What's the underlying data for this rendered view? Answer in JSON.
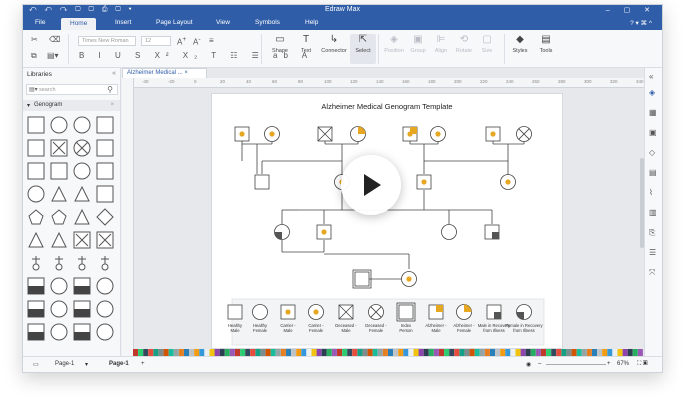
{
  "titlebar": {
    "title": "Edraw Max",
    "quick_access": "⤺ ↶ ↷ ▢ ▢ ⎙ ▢ ▾",
    "window_controls": "– ▢ ✕"
  },
  "menu": {
    "tabs": [
      "File",
      "Home",
      "Insert",
      "Page Layout",
      "View",
      "Symbols",
      "Help"
    ],
    "active": "Home",
    "right": "? ▾  ⌘  ^"
  },
  "ribbon": {
    "font_name": "Times New Roman",
    "font_size": "12",
    "buttons": [
      {
        "label": "Shape",
        "glyph": "▭"
      },
      {
        "label": "Text",
        "glyph": "T"
      },
      {
        "label": "Connector",
        "glyph": "↳"
      },
      {
        "label": "Select",
        "glyph": "⇱"
      },
      {
        "label": "Position",
        "glyph": "◈"
      },
      {
        "label": "Group",
        "glyph": "▣"
      },
      {
        "label": "Align",
        "glyph": "⊫"
      },
      {
        "label": "Rotate",
        "glyph": "⟲"
      },
      {
        "label": "Size",
        "glyph": "▢"
      },
      {
        "label": "Styles",
        "glyph": "◆"
      },
      {
        "label": "Tools",
        "glyph": "▤"
      }
    ]
  },
  "libraries": {
    "header": "Libraries",
    "search_placeholder": "search",
    "group": "Genogram"
  },
  "document": {
    "tab": "Alzheimer Medical ...",
    "title": "Alzheimer Medical Genogram Template",
    "ruler_marks": [
      "-40",
      "-20",
      "0",
      "20",
      "40",
      "60",
      "80",
      "100",
      "120",
      "140",
      "160",
      "180",
      "200",
      "220",
      "240",
      "260",
      "280",
      "300",
      "320",
      "340"
    ]
  },
  "legend": [
    "Healthy Male",
    "Healthy Female",
    "Carrier - Male",
    "Carrier - Female",
    "Deceased - Male",
    "Deceased - Female",
    "Index Person",
    "Alzheimer - Male",
    "Alzheimer - Female",
    "Male in Recovery from Illness",
    "Female in Recovery from Illness"
  ],
  "status": {
    "page_tab": "Page-1",
    "page_current": "Page-1",
    "add": "+",
    "zoom": "67%"
  },
  "colors": {
    "accent": "#2f5da8",
    "carrier": "#e6a823"
  }
}
